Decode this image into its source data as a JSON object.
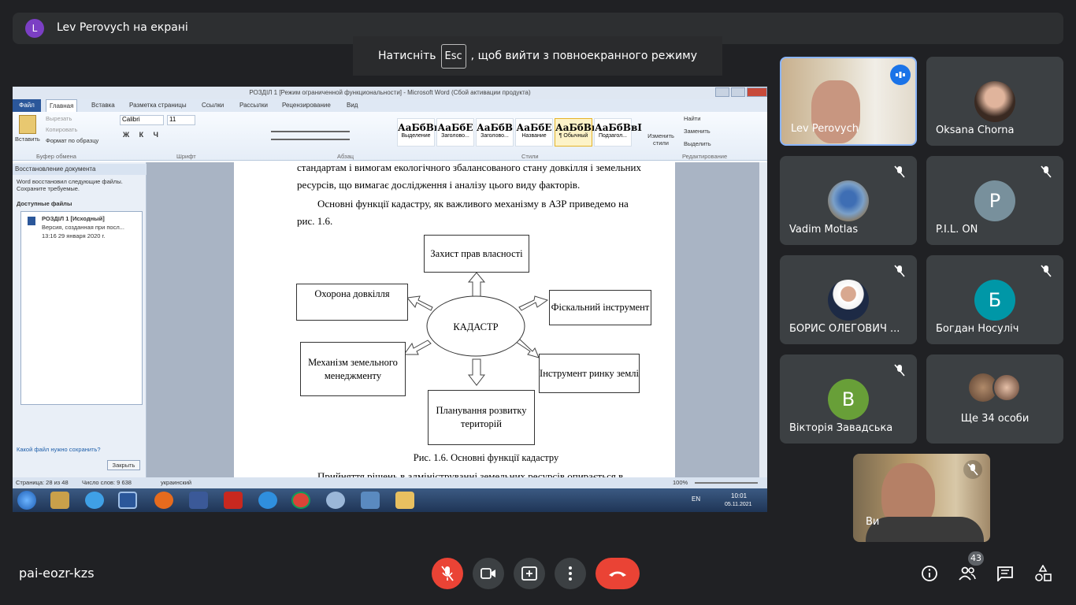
{
  "top_bar": {
    "avatar_letter": "L",
    "presenting_text": "Lev Perovych на екрані"
  },
  "esc_notice": {
    "before": "Натисніть",
    "key": "Esc",
    "after": ", щоб вийти з повноекранного режиму"
  },
  "word": {
    "title": "РОЗДІЛ 1 [Режим ограниченной функциональности] - Microsoft Word (Сбой активации продукта)",
    "tabs": [
      "Файл",
      "Главная",
      "Вставка",
      "Разметка страницы",
      "Ссылки",
      "Рассылки",
      "Рецензирование",
      "Вид"
    ],
    "clipboard": {
      "paste": "Вставить",
      "cut": "Вырезать",
      "copy": "Копировать",
      "format_painter": "Формат по образцу",
      "group": "Буфер обмена"
    },
    "font": {
      "name": "Calibri",
      "size": "11",
      "group": "Шрифт"
    },
    "paragraph_group": "Абзац",
    "styles": [
      {
        "sample": "АаБбВвГг",
        "name": "Выделение"
      },
      {
        "sample": "АаБбE",
        "name": "Заголово..."
      },
      {
        "sample": "АаБбВ",
        "name": "Заголово..."
      },
      {
        "sample": "АаБбЕ",
        "name": "Название"
      },
      {
        "sample": "АаБбВвГг,",
        "name": "¶ Обычный"
      },
      {
        "sample": "АаБбВвI",
        "name": "Подзагол..."
      }
    ],
    "styles_group": "Стили",
    "change_styles": "Изменить стили",
    "editing": {
      "find": "Найти",
      "replace": "Заменить",
      "select": "Выделить",
      "group": "Редактирование"
    },
    "recovery": {
      "title": "Восстановление документа",
      "message": "Word восстановил следующие файлы. Сохраните требуемые.",
      "available": "Доступные файлы",
      "file_name": "РОЗДІЛ 1 [Исходный]",
      "file_desc": "Версия, созданная при посл...",
      "file_date": "13:16 29 января 2020 г.",
      "help_link": "Какой файл нужно сохранить?",
      "close_btn": "Закрыть"
    },
    "document": {
      "line1": "стандартам і вимогам екологічного збалансованого стану довкілля і земельних",
      "line2": "ресурсів, що вимагає дослідження і аналізу цього виду факторів.",
      "para2_line1": "Основні функції кадастру, як важливого механізму в АЗР приведемо на",
      "para2_line2": "рис. 1.6.",
      "diagram": {
        "center": "КАДАСТР",
        "top": "Захист прав власності",
        "top_right": "Фіскальний інструмент",
        "bottom_right": "Інструмент ринку землі",
        "bottom": "Планування розвитку територій",
        "bottom_left": "Механізм земельного менеджменту",
        "top_left": "Охорона довкілля"
      },
      "caption": "Рис. 1.6. Основні функції кадастру",
      "cut_line": "Прийняття рішень в адмініструванні земельних ресурсів опирається в"
    },
    "status": {
      "page": "Страница: 28 из 48",
      "words": "Число слов: 9 638",
      "lang": "украинский",
      "zoom": "100%"
    },
    "taskbar": {
      "lang": "EN",
      "time": "10:01",
      "date": "05.11.2021"
    }
  },
  "participants": [
    {
      "name": "Lev Perovych",
      "kind": "video"
    },
    {
      "name": "Oksana Chorna",
      "kind": "photo"
    },
    {
      "name": "Vadim Motlas",
      "kind": "photo"
    },
    {
      "name": "P.I.L. ON",
      "letter": "P",
      "color": "#78909c"
    },
    {
      "name": "БОРИС ОЛЕГОВИЧ ...",
      "kind": "photo"
    },
    {
      "name": "Богдан Носуліч",
      "letter": "Б",
      "color": "#0097a7"
    },
    {
      "name": "Вікторія Завадська",
      "letter": "В",
      "color": "#689f38"
    },
    {
      "name": "Ще 34 особи",
      "kind": "others"
    }
  ],
  "self_view": {
    "name": "Ви"
  },
  "meeting_code": "pai-eozr-kzs",
  "people_count": "43",
  "colors": {
    "end_call": "#ea4335",
    "mic_off": "#ea4335",
    "active_border": "#8ab4f8"
  }
}
